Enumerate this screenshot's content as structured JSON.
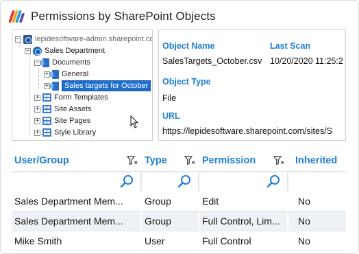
{
  "header": {
    "title": "Permissions by SharePoint Objects"
  },
  "tree": {
    "nodes": [
      {
        "label": "lepidesoftware-admin.sharepoint.co",
        "expander": "−",
        "icon": "sharepoint-site-icon"
      },
      {
        "label": "Sales Department",
        "expander": "−",
        "icon": "site-globe-icon"
      },
      {
        "label": "Documents",
        "expander": "−",
        "icon": "document-library-icon"
      },
      {
        "label": "General",
        "expander": "+",
        "icon": "folder-library-icon"
      },
      {
        "label": "Sales targets for October",
        "expander": "+",
        "icon": "folder-library-icon"
      },
      {
        "label": "Form Templates",
        "expander": "+",
        "icon": "list-grid-icon"
      },
      {
        "label": "Site Assets",
        "expander": "+",
        "icon": "list-grid-icon"
      },
      {
        "label": "Site Pages",
        "expander": "+",
        "icon": "list-grid-icon"
      },
      {
        "label": "Style Library",
        "expander": "+",
        "icon": "list-grid-icon"
      }
    ],
    "selected": "Sales targets for October"
  },
  "details": {
    "object_name_label": "Object Name",
    "object_name_value": "SalesTargets_October.csv",
    "last_scan_label": "Last Scan",
    "last_scan_value": "10/20/2020 11:25:2",
    "object_type_label": "Object Type",
    "object_type_value": "File",
    "url_label": "URL",
    "url_value": "https://lepidesoftware.sharepoint.com/sites/S"
  },
  "table": {
    "columns": [
      "User/Group",
      "Type",
      "Permission",
      "Inherited"
    ],
    "rows": [
      [
        "Sales Department Mem...",
        "Group",
        "Edit",
        "No"
      ],
      [
        "Sales Department Mem...",
        "Group",
        "Full Control, Lim...",
        "No"
      ],
      [
        "Mike Smith",
        "User",
        "Full Control",
        "No"
      ]
    ]
  },
  "colors": {
    "accent": "#1d7fd6",
    "selection": "#1e6fd0",
    "row_alt": "#eef2f7"
  }
}
